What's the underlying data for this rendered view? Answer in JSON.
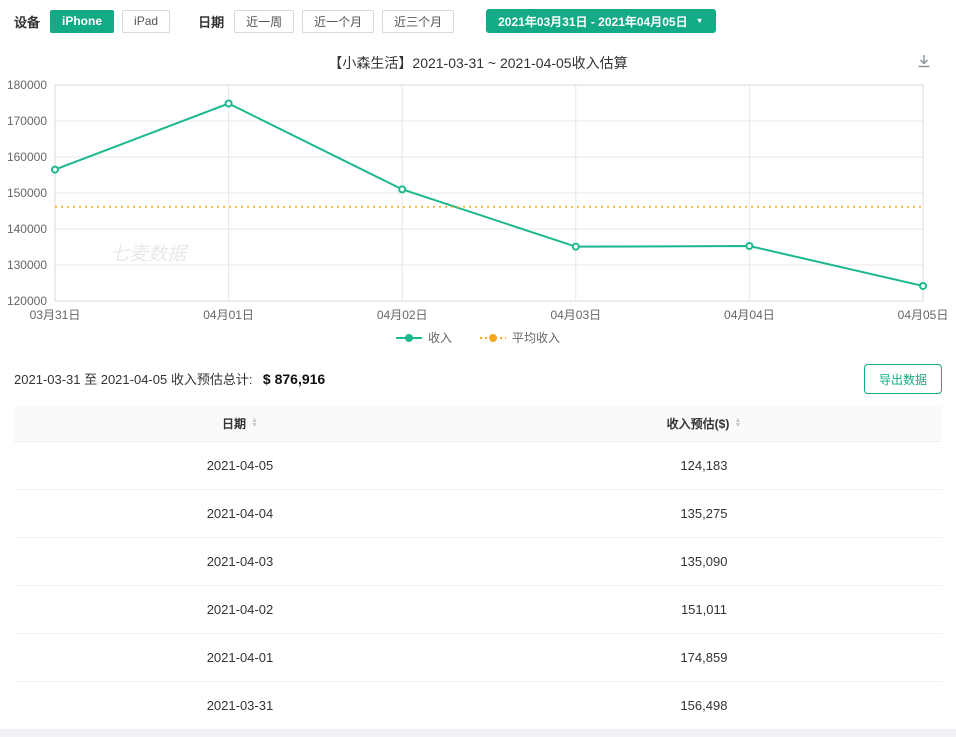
{
  "colors": {
    "accent": "#12ab85",
    "average": "#f6a821",
    "grid": "#e7e7e7",
    "border": "#d9d9d9",
    "axis_text": "#666666"
  },
  "toolbar": {
    "device_label": "设备",
    "devices": [
      {
        "label": "iPhone"
      },
      {
        "label": "iPad"
      }
    ],
    "active_device": "iPhone",
    "date_label": "日期",
    "presets": [
      "近一周",
      "近一个月",
      "近三个月"
    ],
    "date_range": "2021年03月31日 - 2021年04月05日"
  },
  "chart": {
    "title": "【小森生活】2021-03-31 ~ 2021-04-05收入估算",
    "watermark": "七麦数据"
  },
  "chart_data": {
    "type": "line",
    "x": [
      "03月31日",
      "04月01日",
      "04月02日",
      "04月03日",
      "04月04日",
      "04月05日"
    ],
    "series": [
      {
        "name": "收入",
        "values": [
          156498,
          174859,
          151011,
          135090,
          135275,
          124183
        ],
        "color": "#1bb88e",
        "style": "solid"
      },
      {
        "name": "平均收入",
        "values": [
          146153,
          146153,
          146153,
          146153,
          146153,
          146153
        ],
        "color": "#f6a821",
        "style": "dotted"
      }
    ],
    "ylim": [
      120000,
      180000
    ],
    "yticks": [
      120000,
      130000,
      140000,
      150000,
      160000,
      170000,
      180000
    ],
    "legend": [
      "收入",
      "平均收入"
    ],
    "legend_position": "bottom",
    "grid": true
  },
  "summary": {
    "label": "2021-03-31 至 2021-04-05 收入预估总计:",
    "amount": "$ 876,916",
    "export_label": "导出数据"
  },
  "table": {
    "columns": [
      "日期",
      "收入预估($)"
    ],
    "rows": [
      [
        "2021-04-05",
        "124,183"
      ],
      [
        "2021-04-04",
        "135,275"
      ],
      [
        "2021-04-03",
        "135,090"
      ],
      [
        "2021-04-02",
        "151,011"
      ],
      [
        "2021-04-01",
        "174,859"
      ],
      [
        "2021-03-31",
        "156,498"
      ]
    ]
  },
  "icons": {
    "caret_down": "▼",
    "sort_asc": "▲",
    "sort_desc": "▼"
  }
}
